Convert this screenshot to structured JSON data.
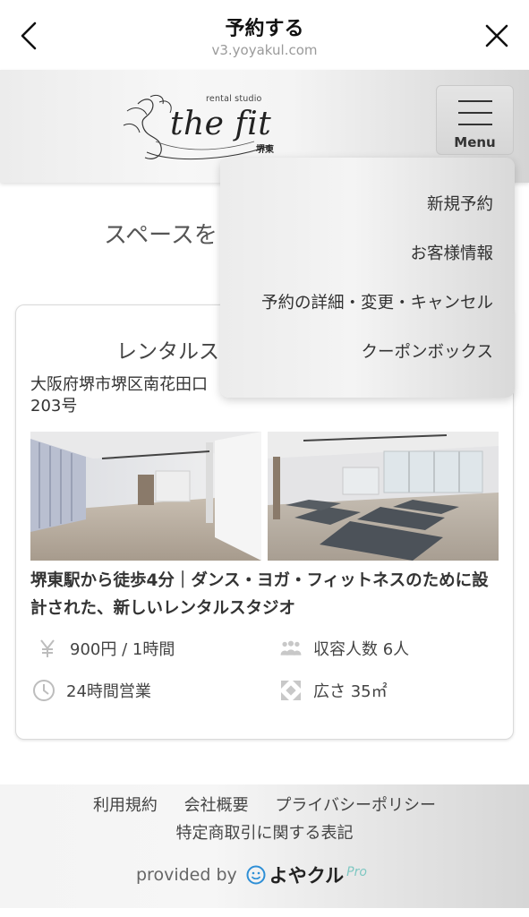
{
  "browser": {
    "title": "予約する",
    "url": "v3.yoyakul.com"
  },
  "header": {
    "logo": {
      "tagline": "rental studio",
      "name": "the fit",
      "branch": "堺東"
    },
    "menu_label": "Menu"
  },
  "dropdown": {
    "items": [
      {
        "label": "新規予約"
      },
      {
        "label": "お客様情報"
      },
      {
        "label": "予約の詳細・変更・キャンセル"
      },
      {
        "label": "クーポンボックス"
      }
    ]
  },
  "main": {
    "heading": "スペースを",
    "card": {
      "name": "レンタルス",
      "address": "大阪府堺市堺区南花田口\n203号",
      "description": "堺東駅から徒歩4分｜ダンス・ヨガ・フィットネスのために設計された、新しいレンタルスタジオ",
      "price": "900円 / 1時間",
      "capacity": "収容人数 6人",
      "hours": "24時間営業",
      "area": "広さ 35㎡"
    }
  },
  "footer": {
    "links": [
      "利用規約",
      "会社概要",
      "プライバシーポリシー"
    ],
    "link_tokushoho": "特定商取引に関する表記",
    "provided_by": "provided by",
    "brand_name": "よやクル",
    "brand_suffix": "Pro"
  },
  "colors": {
    "text": "#333333",
    "muted": "#9a9a9a",
    "brand_accent": "#2e8fd6",
    "pro_accent": "#7ec7c2"
  }
}
